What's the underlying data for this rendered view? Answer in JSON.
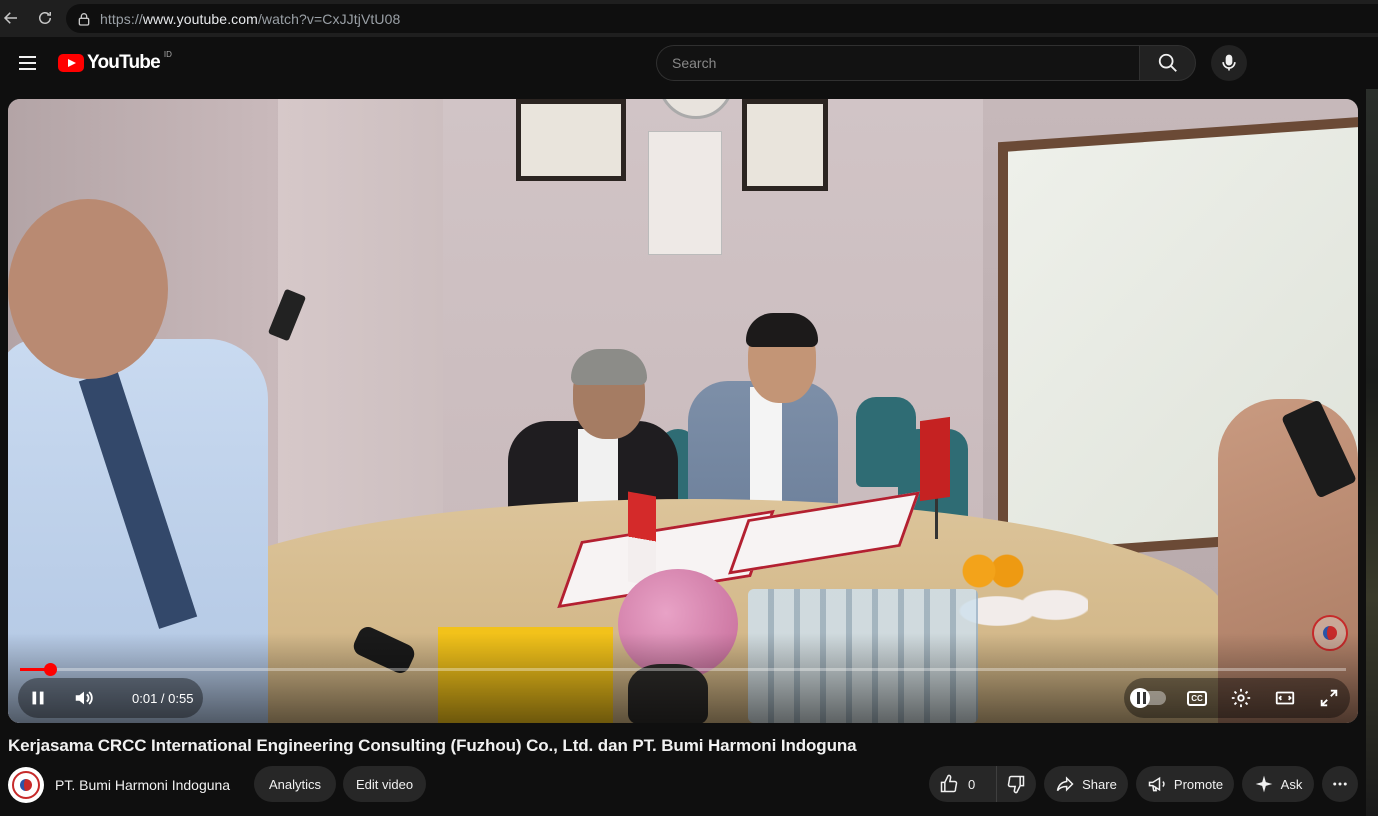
{
  "browser": {
    "url_prefix": "https://",
    "url_domain": "www.youtube.com",
    "url_path": "/watch?v=CxJJtjVtU08"
  },
  "masthead": {
    "logo_text": "YouTube",
    "country_code": "ID",
    "search_placeholder": "Search"
  },
  "player": {
    "current_time": "0:01",
    "duration": "0:55",
    "time_display": "0:01 / 0:55",
    "progress_fraction": 0.023,
    "cc_label": "CC",
    "accent_color": "#ff0000"
  },
  "video": {
    "title": "Kerjasama CRCC International Engineering Consulting (Fuzhou) Co., Ltd. dan PT. Bumi Harmoni Indoguna"
  },
  "owner": {
    "channel_name": "PT. Bumi Harmoni Indoguna",
    "analytics_label": "Analytics",
    "edit_label": "Edit video"
  },
  "actions": {
    "like_count": "0",
    "share_label": "Share",
    "promote_label": "Promote",
    "ask_label": "Ask"
  }
}
